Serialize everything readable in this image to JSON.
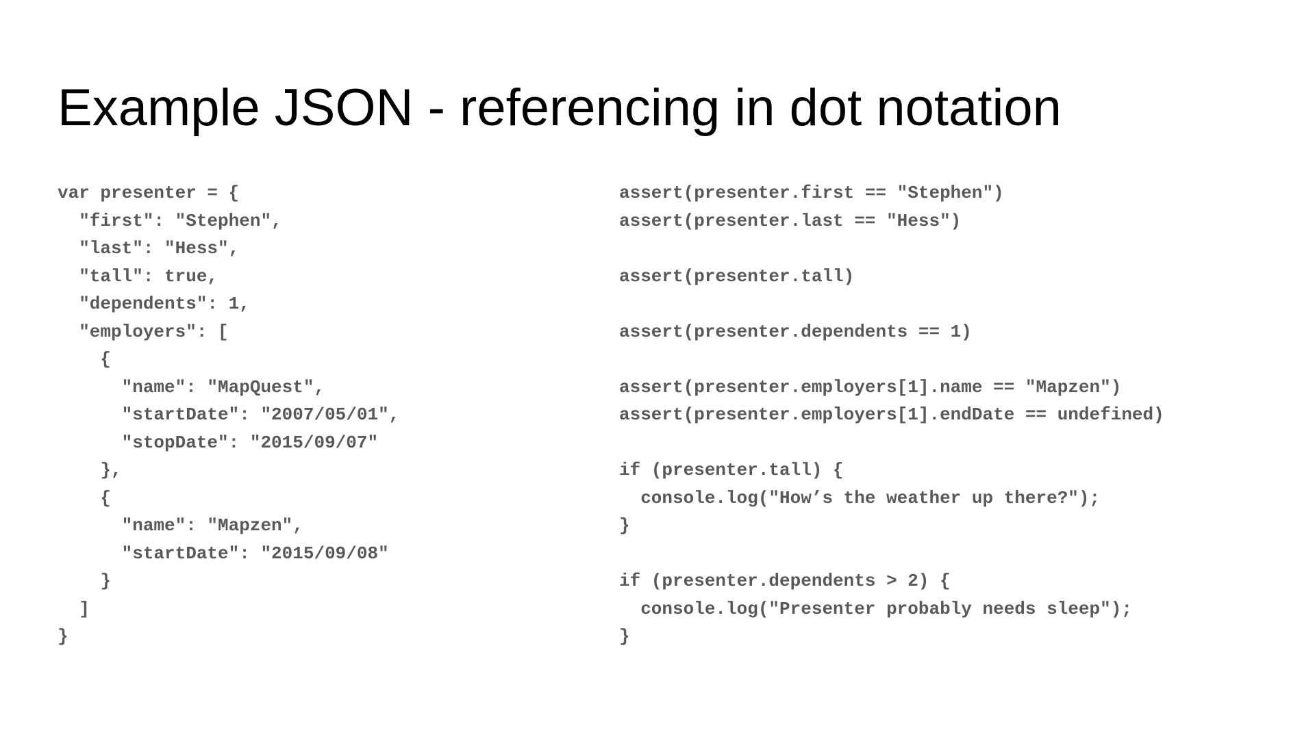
{
  "slide": {
    "title": "Example JSON - referencing in dot notation"
  },
  "left_code": {
    "lines": [
      "var presenter = {",
      "  \"first\": \"Stephen\",",
      "  \"last\": \"Hess\",",
      "  \"tall\": true,",
      "  \"dependents\": 1,",
      "  \"employers\": [",
      "    {",
      "      \"name\": \"MapQuest\",",
      "      \"startDate\": \"2007/05/01\",",
      "      \"stopDate\": \"2015/09/07\"",
      "    },",
      "    {",
      "      \"name\": \"Mapzen\",",
      "      \"startDate\": \"2015/09/08\"",
      "    }",
      "  ]",
      "}"
    ]
  },
  "right_code": {
    "lines": [
      "assert(presenter.first == \"Stephen\")",
      "assert(presenter.last == \"Hess\")",
      "",
      "assert(presenter.tall)",
      "",
      "assert(presenter.dependents == 1)",
      "",
      "assert(presenter.employers[1].name == \"Mapzen\")",
      "assert(presenter.employers[1].endDate == undefined)",
      "",
      "if (presenter.tall) {",
      "  console.log(\"How’s the weather up there?\");",
      "}",
      "",
      "if (presenter.dependents > 2) {",
      "  console.log(\"Presenter probably needs sleep\");",
      "}"
    ]
  }
}
